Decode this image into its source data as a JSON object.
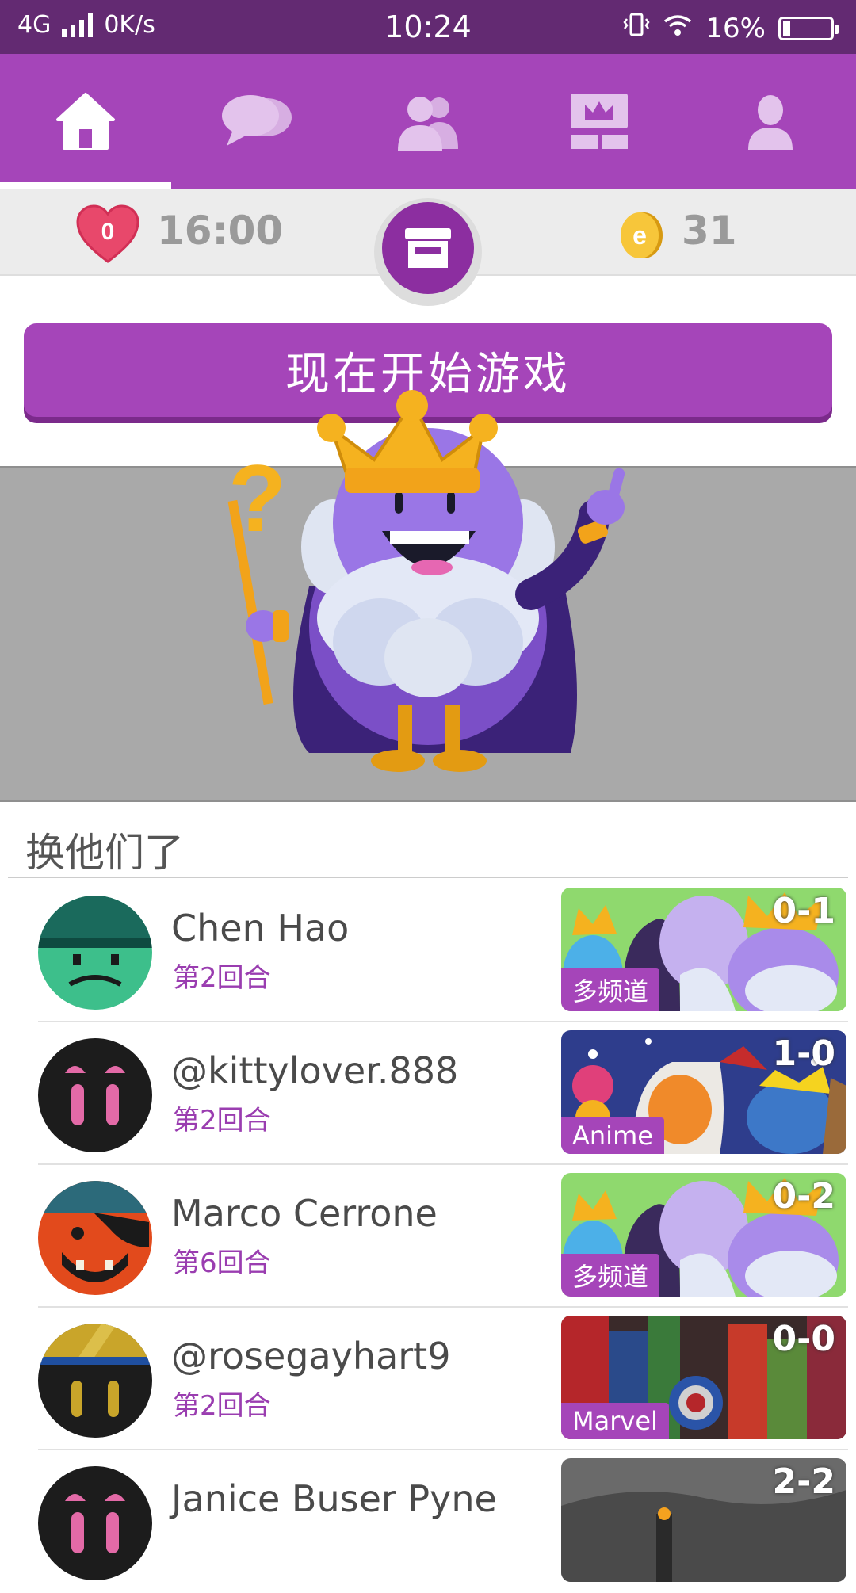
{
  "status_bar": {
    "network": "4G",
    "speed": "0K/s",
    "time": "10:24",
    "battery": "16%",
    "battery_level": 0.16
  },
  "nav": {
    "tabs": [
      {
        "id": "home",
        "icon": "home-icon",
        "active": true
      },
      {
        "id": "chat",
        "icon": "chat-bubbles-icon",
        "active": false
      },
      {
        "id": "friends",
        "icon": "friends-icon",
        "active": false
      },
      {
        "id": "ranking",
        "icon": "crown-board-icon",
        "active": false
      },
      {
        "id": "profile",
        "icon": "user-icon",
        "active": false
      }
    ]
  },
  "stats": {
    "lives": "0",
    "lives_timer": "16:00",
    "coins": "31",
    "shop_icon": "shop-icon"
  },
  "play_button": {
    "label": "现在开始游戏"
  },
  "section": {
    "title": "换他们了"
  },
  "games": [
    {
      "name": "Chen Hao",
      "round": "第2回合",
      "score": "0-1",
      "category": "多频道",
      "avatar": "green-frown"
    },
    {
      "name": "@kittylover.888",
      "round": "第2回合",
      "score": "1-0",
      "category": "Anime",
      "avatar": "black-pink"
    },
    {
      "name": "Marco Cerrone",
      "round": "第6回合",
      "score": "0-2",
      "category": "多频道",
      "avatar": "pirate-red"
    },
    {
      "name": "@rosegayhart9",
      "round": "第2回合",
      "score": "0-0",
      "category": "Marvel",
      "avatar": "black-gold"
    },
    {
      "name": "Janice Buser Pyne",
      "round": "",
      "score": "2-2",
      "category": "",
      "avatar": "black-pink"
    }
  ],
  "colors": {
    "brand_purple": "#a545b9",
    "status_bar": "#632a72",
    "accent_text": "#9a3db0"
  }
}
